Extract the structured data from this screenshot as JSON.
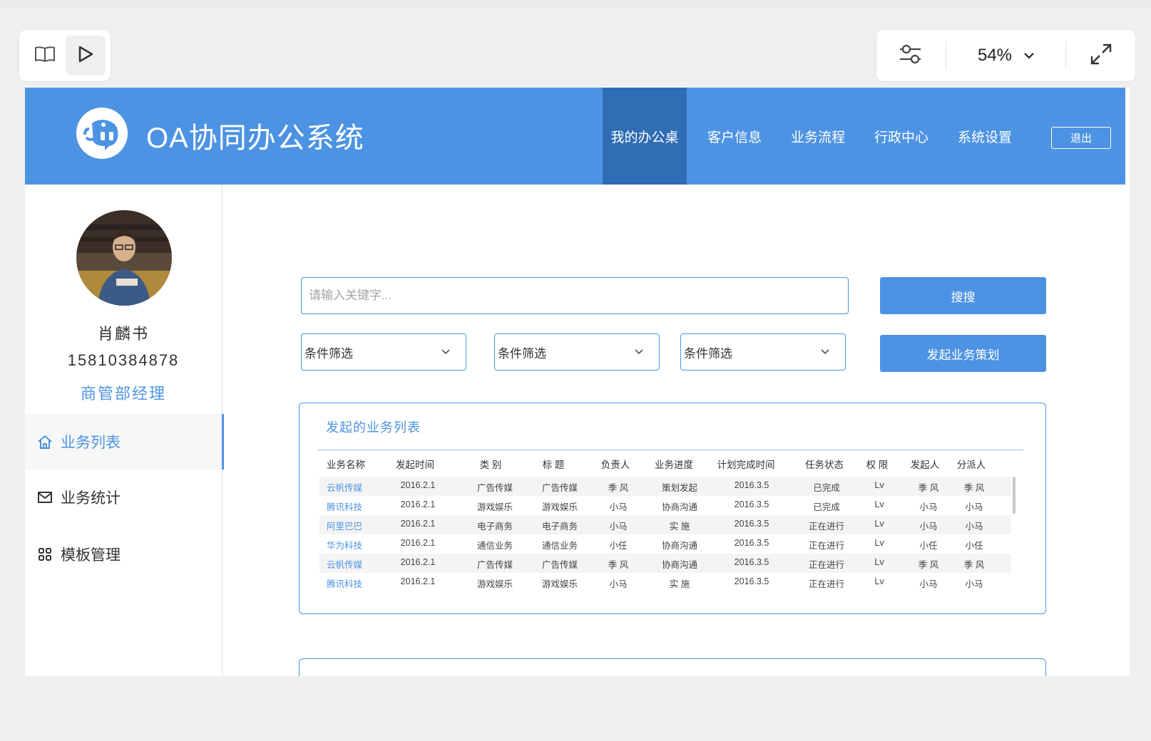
{
  "viewer": {
    "zoom": "54%"
  },
  "app": {
    "title": "OA协同办公系统",
    "nav": [
      {
        "label": "我的办公桌",
        "active": true
      },
      {
        "label": "客户信息",
        "active": false
      },
      {
        "label": "业务流程",
        "active": false
      },
      {
        "label": "行政中心",
        "active": false
      },
      {
        "label": "系统设置",
        "active": false
      }
    ],
    "logout_label": "退出",
    "brand_color": "#4d93e3",
    "active_nav_color": "#2f6db4"
  },
  "user": {
    "name": "肖麟书",
    "phone": "15810384878",
    "role": "商管部经理"
  },
  "sidebar": {
    "items": [
      {
        "label": "业务列表",
        "icon": "home-icon",
        "active": true
      },
      {
        "label": "业务统计",
        "icon": "mail-icon",
        "active": false
      },
      {
        "label": "模板管理",
        "icon": "grid-icon",
        "active": false
      }
    ]
  },
  "search": {
    "placeholder": "请输入关键字...",
    "button_label": "搜搜",
    "create_button_label": "发起业务策划"
  },
  "filters": [
    {
      "value": "条件筛选"
    },
    {
      "value": "条件筛选"
    },
    {
      "value": "条件筛选"
    }
  ],
  "business_list": {
    "title": "发起的业务列表",
    "columns": [
      "业务名称",
      "发起时间",
      "类 别",
      "标 题",
      "负责人",
      "业务进度",
      "计划完成时间",
      "任务状态",
      "权 限",
      "发起人",
      "分派人"
    ],
    "rows": [
      [
        "云帆传媒",
        "2016.2.1",
        "广告传媒",
        "广告传媒",
        "季 风",
        "策划发起",
        "2016.3.5",
        "已完成",
        "Lv",
        "季 风",
        "季 风"
      ],
      [
        "腾讯科技",
        "2016.2.1",
        "游戏娱乐",
        "游戏娱乐",
        "小马",
        "协商沟通",
        "2016.3.5",
        "已完成",
        "Lv",
        "小马",
        "小马"
      ],
      [
        "阿里巴巴",
        "2016.2.1",
        "电子商务",
        "电子商务",
        "小马",
        "实 施",
        "2016.3.5",
        "正在进行",
        "Lv",
        "小马",
        "小马"
      ],
      [
        "华为科技",
        "2016.2.1",
        "通信业务",
        "通信业务",
        "小任",
        "协商沟通",
        "2016.3.5",
        "正在进行",
        "Lv",
        "小任",
        "小任"
      ],
      [
        "云帆传媒",
        "2016.2.1",
        "广告传媒",
        "广告传媒",
        "季 风",
        "协商沟通",
        "2016.3.5",
        "正在进行",
        "Lv",
        "季 风",
        "季 风"
      ],
      [
        "腾讯科技",
        "2016.2.1",
        "游戏娱乐",
        "游戏娱乐",
        "小马",
        "实 施",
        "2016.3.5",
        "正在进行",
        "Lv",
        "小马",
        "小马"
      ]
    ]
  }
}
